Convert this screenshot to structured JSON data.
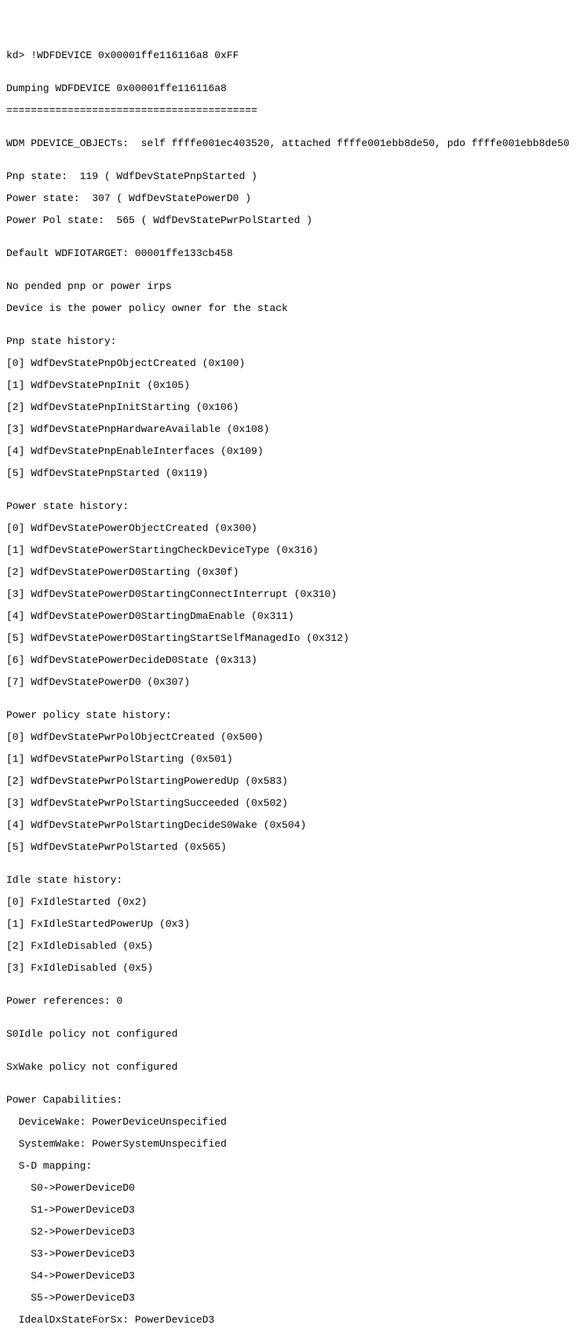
{
  "prompt": "kd> !WDFDEVICE 0x00001ffe116116a8 0xFF",
  "blank1": "",
  "header1": "Dumping WDFDEVICE 0x00001ffe116116a8",
  "divider": "=========================================",
  "blank2": "",
  "wdm_line": "WDM PDEVICE_OBJECTs:  self ffffe001ec403520, attached ffffe001ebb8de50, pdo ffffe001ebb8de50",
  "blank3": "",
  "pnp_state": "Pnp state:  119 ( WdfDevStatePnpStarted )",
  "pwr_state": "Power state:  307 ( WdfDevStatePowerD0 )",
  "pwrpol_state": "Power Pol state:  565 ( WdfDevStatePwrPolStarted )",
  "blank4": "",
  "default_target": "Default WDFIOTARGET: 00001ffe133cb458",
  "blank5": "",
  "no_pended": "No pended pnp or power irps",
  "device_owner": "Device is the power policy owner for the stack",
  "blank6": "",
  "pnp_hist_hdr": "Pnp state history:",
  "pnp_hist_0": "[0] WdfDevStatePnpObjectCreated (0x100)",
  "pnp_hist_1": "[1] WdfDevStatePnpInit (0x105)",
  "pnp_hist_2": "[2] WdfDevStatePnpInitStarting (0x106)",
  "pnp_hist_3": "[3] WdfDevStatePnpHardwareAvailable (0x108)",
  "pnp_hist_4": "[4] WdfDevStatePnpEnableInterfaces (0x109)",
  "pnp_hist_5": "[5] WdfDevStatePnpStarted (0x119)",
  "blank7": "",
  "pwr_hist_hdr": "Power state history:",
  "pwr_hist_0": "[0] WdfDevStatePowerObjectCreated (0x300)",
  "pwr_hist_1": "[1] WdfDevStatePowerStartingCheckDeviceType (0x316)",
  "pwr_hist_2": "[2] WdfDevStatePowerD0Starting (0x30f)",
  "pwr_hist_3": "[3] WdfDevStatePowerD0StartingConnectInterrupt (0x310)",
  "pwr_hist_4": "[4] WdfDevStatePowerD0StartingDmaEnable (0x311)",
  "pwr_hist_5": "[5] WdfDevStatePowerD0StartingStartSelfManagedIo (0x312)",
  "pwr_hist_6": "[6] WdfDevStatePowerDecideD0State (0x313)",
  "pwr_hist_7": "[7] WdfDevStatePowerD0 (0x307)",
  "blank8": "",
  "pol_hist_hdr": "Power policy state history:",
  "pol_hist_0": "[0] WdfDevStatePwrPolObjectCreated (0x500)",
  "pol_hist_1": "[1] WdfDevStatePwrPolStarting (0x501)",
  "pol_hist_2": "[2] WdfDevStatePwrPolStartingPoweredUp (0x583)",
  "pol_hist_3": "[3] WdfDevStatePwrPolStartingSucceeded (0x502)",
  "pol_hist_4": "[4] WdfDevStatePwrPolStartingDecideS0Wake (0x504)",
  "pol_hist_5": "[5] WdfDevStatePwrPolStarted (0x565)",
  "blank9": "",
  "idle_hdr": "Idle state history:",
  "idle_0": "[0] FxIdleStarted (0x2)",
  "idle_1": "[1] FxIdleStartedPowerUp (0x3)",
  "idle_2": "[2] FxIdleDisabled (0x5)",
  "idle_3": "[3] FxIdleDisabled (0x5)",
  "blank10": "",
  "pwr_refs": "Power references: 0",
  "blank11": "",
  "s0idle": "S0Idle policy not configured",
  "blank12": "",
  "sxwake": "SxWake policy not configured",
  "blank13": "",
  "pcap_hdr": "Power Capabilities:",
  "pcap_devwake": "  DeviceWake: PowerDeviceUnspecified",
  "pcap_syswake": "  SystemWake: PowerSystemUnspecified",
  "pcap_sd_hdr": "  S-D mapping:",
  "pcap_s0": "    S0->PowerDeviceD0",
  "pcap_s1": "    S1->PowerDeviceD3",
  "pcap_s2": "    S2->PowerDeviceD3",
  "pcap_s3": "    S3->PowerDeviceD3",
  "pcap_s4": "    S4->PowerDeviceD3",
  "pcap_s5": "    S5->PowerDeviceD3",
  "pcap_ideal": "  IdealDxStateForSx: PowerDeviceD3"
}
